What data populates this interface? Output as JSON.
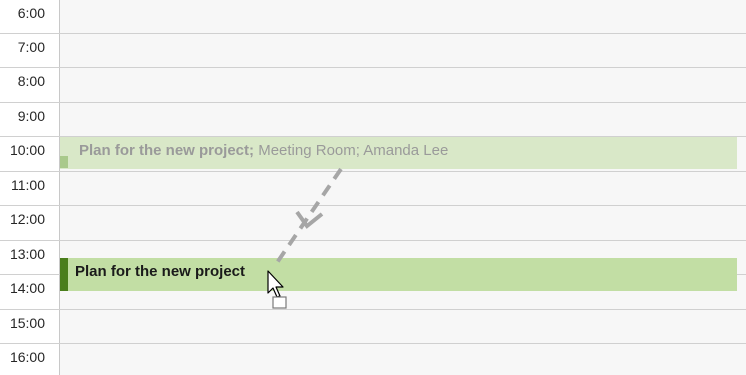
{
  "times": [
    "6:00",
    "7:00",
    "8:00",
    "9:00",
    "10:00",
    "11:00",
    "12:00",
    "13:00",
    "14:00",
    "15:00",
    "16:00"
  ],
  "ghost_appointment": {
    "title": "Plan for the new project;",
    "details": " Meeting Room; Amanda Lee"
  },
  "main_appointment": {
    "title": "Plan for the new project"
  },
  "colors": {
    "ghost_fill": "#d9e8c8",
    "main_fill": "#c2dea4",
    "accent": "#4a7e1c"
  },
  "icons": {
    "drag_arrow": "dashed-arrow-icon",
    "cursor": "move-cursor-icon"
  }
}
